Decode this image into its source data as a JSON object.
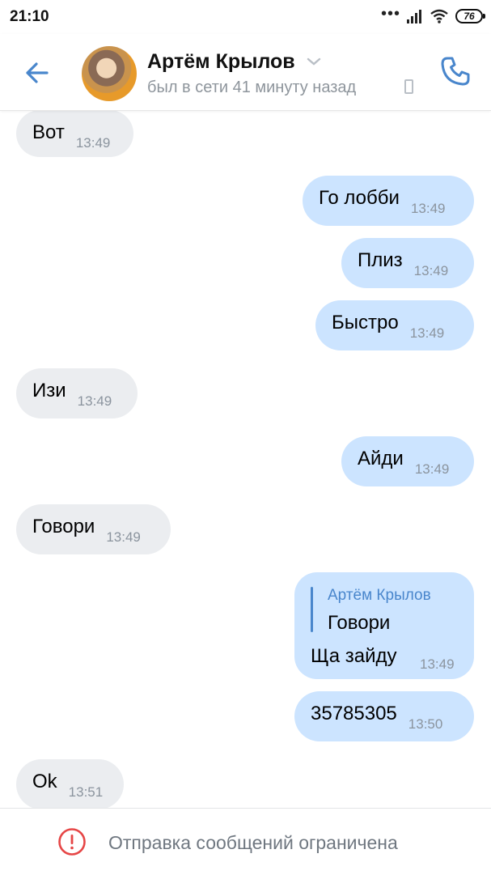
{
  "status_bar": {
    "time": "21:10",
    "signal_dots": "•••",
    "battery": "76"
  },
  "header": {
    "contact_name": "Артём Крылов",
    "last_seen": "был в сети 41 минуту назад",
    "icons": {
      "back": "back-arrow-icon",
      "call": "phone-icon",
      "device": "mobile-device-icon",
      "menu": "chevron-down-icon"
    },
    "accent_color": "#4986cc"
  },
  "messages": [
    {
      "direction": "incoming",
      "text": "Вот",
      "time": "13:49"
    },
    {
      "direction": "outgoing",
      "text": "Го лобби",
      "time": "13:49"
    },
    {
      "direction": "outgoing",
      "text": "Плиз",
      "time": "13:49"
    },
    {
      "direction": "outgoing",
      "text": "Быстро",
      "time": "13:49"
    },
    {
      "direction": "incoming",
      "text": "Изи",
      "time": "13:49"
    },
    {
      "direction": "outgoing",
      "text": "Айди",
      "time": "13:49"
    },
    {
      "direction": "incoming",
      "text": "Говори",
      "time": "13:49"
    },
    {
      "direction": "outgoing",
      "reply_to": {
        "author": "Артём Крылов",
        "text": "Говори"
      },
      "text": "Ща зайду",
      "time": "13:49"
    },
    {
      "direction": "outgoing",
      "text": "35785305",
      "time": "13:50"
    },
    {
      "direction": "incoming",
      "text": "Ok",
      "time": "13:51"
    }
  ],
  "footer": {
    "restriction_text": "Отправка сообщений ограничена",
    "icon": "warning-circle-icon",
    "icon_color": "#e64646"
  },
  "colors": {
    "incoming_bubble": "#ebedf0",
    "outgoing_bubble": "#cce4ff"
  }
}
